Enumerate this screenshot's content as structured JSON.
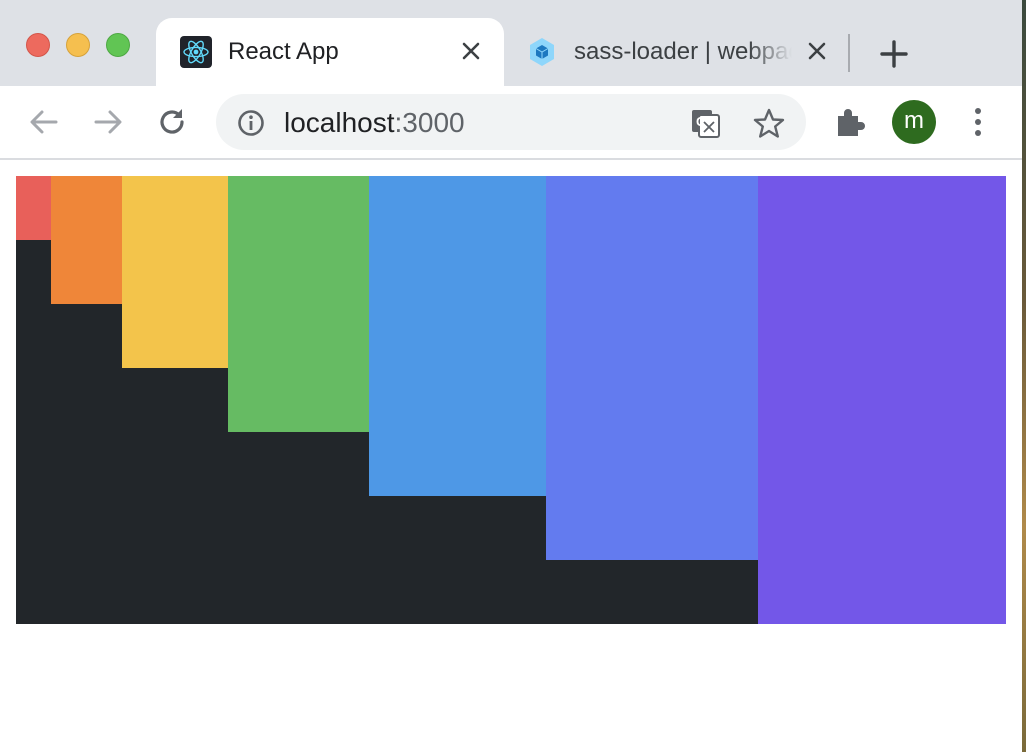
{
  "browser": {
    "tabs": [
      {
        "title": "React App",
        "favicon": "react-icon",
        "active": true
      },
      {
        "title": "sass-loader | webpack",
        "favicon": "webpack-icon",
        "active": false
      }
    ],
    "address_bar": {
      "host": "localhost",
      "port": ":3000"
    },
    "profile_initial": "m",
    "colors": {
      "titlebar": "#dee1e6",
      "avatar": "#2e6b1f"
    }
  },
  "page": {
    "background": "#22262a",
    "bars": [
      {
        "name": "red",
        "color": "#e8605a",
        "fill": 0.143
      },
      {
        "name": "orange",
        "color": "#ef8639",
        "fill": 0.286
      },
      {
        "name": "yellow",
        "color": "#f3c44b",
        "fill": 0.429
      },
      {
        "name": "green",
        "color": "#66bb63",
        "fill": 0.571
      },
      {
        "name": "blue",
        "color": "#4e98e6",
        "fill": 0.714
      },
      {
        "name": "indigo",
        "color": "#637bef",
        "fill": 0.857
      },
      {
        "name": "violet",
        "color": "#7357e8",
        "fill": 1.0
      }
    ]
  }
}
